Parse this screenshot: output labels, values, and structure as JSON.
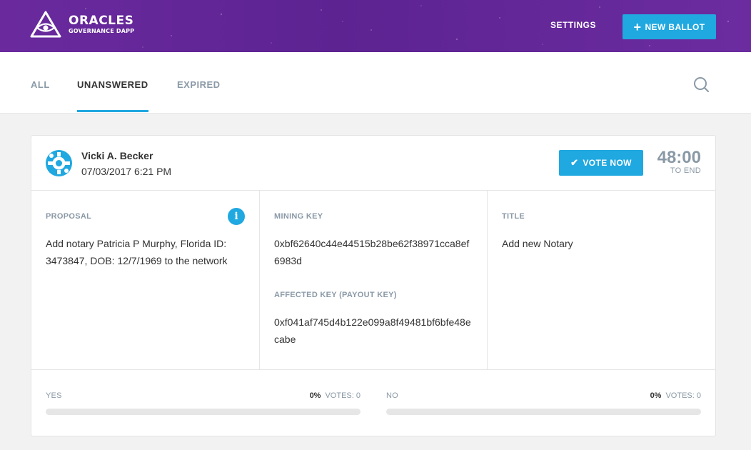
{
  "brand": {
    "title": "ORACLES",
    "subtitle": "GOVERNANCE DAPP"
  },
  "header": {
    "settings_label": "SETTINGS",
    "new_ballot_label": "NEW BALLOT"
  },
  "tabs": [
    {
      "label": "ALL",
      "active": false
    },
    {
      "label": "UNANSWERED",
      "active": true
    },
    {
      "label": "EXPIRED",
      "active": false
    }
  ],
  "ballot": {
    "creator_name": "Vicki A. Becker",
    "created_at": "07/03/2017 6:21 PM",
    "vote_now_label": "VOTE NOW",
    "time_left": "48:00",
    "time_left_label": "TO END",
    "proposal_label": "PROPOSAL",
    "proposal_text": "Add notary Patricia P Murphy, Florida ID: 3473847, DOB: 12/7/1969 to the network",
    "mining_key_label": "MINING KEY",
    "mining_key": "0xbf62640c44e44515b28be62f38971cca8ef6983d",
    "affected_key_label": "AFFECTED KEY (PAYOUT KEY)",
    "affected_key": "0xf041af745d4b122e099a8f49481bf6bfe48ecabe",
    "title_label": "TITLE",
    "title": "Add new Notary",
    "yes": {
      "label": "YES",
      "percent": "0%",
      "votes": "VOTES: 0",
      "fraction": 0
    },
    "no": {
      "label": "NO",
      "percent": "0%",
      "votes": "VOTES: 0",
      "fraction": 0
    }
  },
  "colors": {
    "accent": "#20a8e0",
    "header": "#5d2391",
    "muted": "#8a99a6"
  },
  "icons": {
    "search": "search-icon",
    "info": "info-icon",
    "check": "check-icon",
    "plus": "plus-icon",
    "logo": "eye-triangle-logo"
  }
}
